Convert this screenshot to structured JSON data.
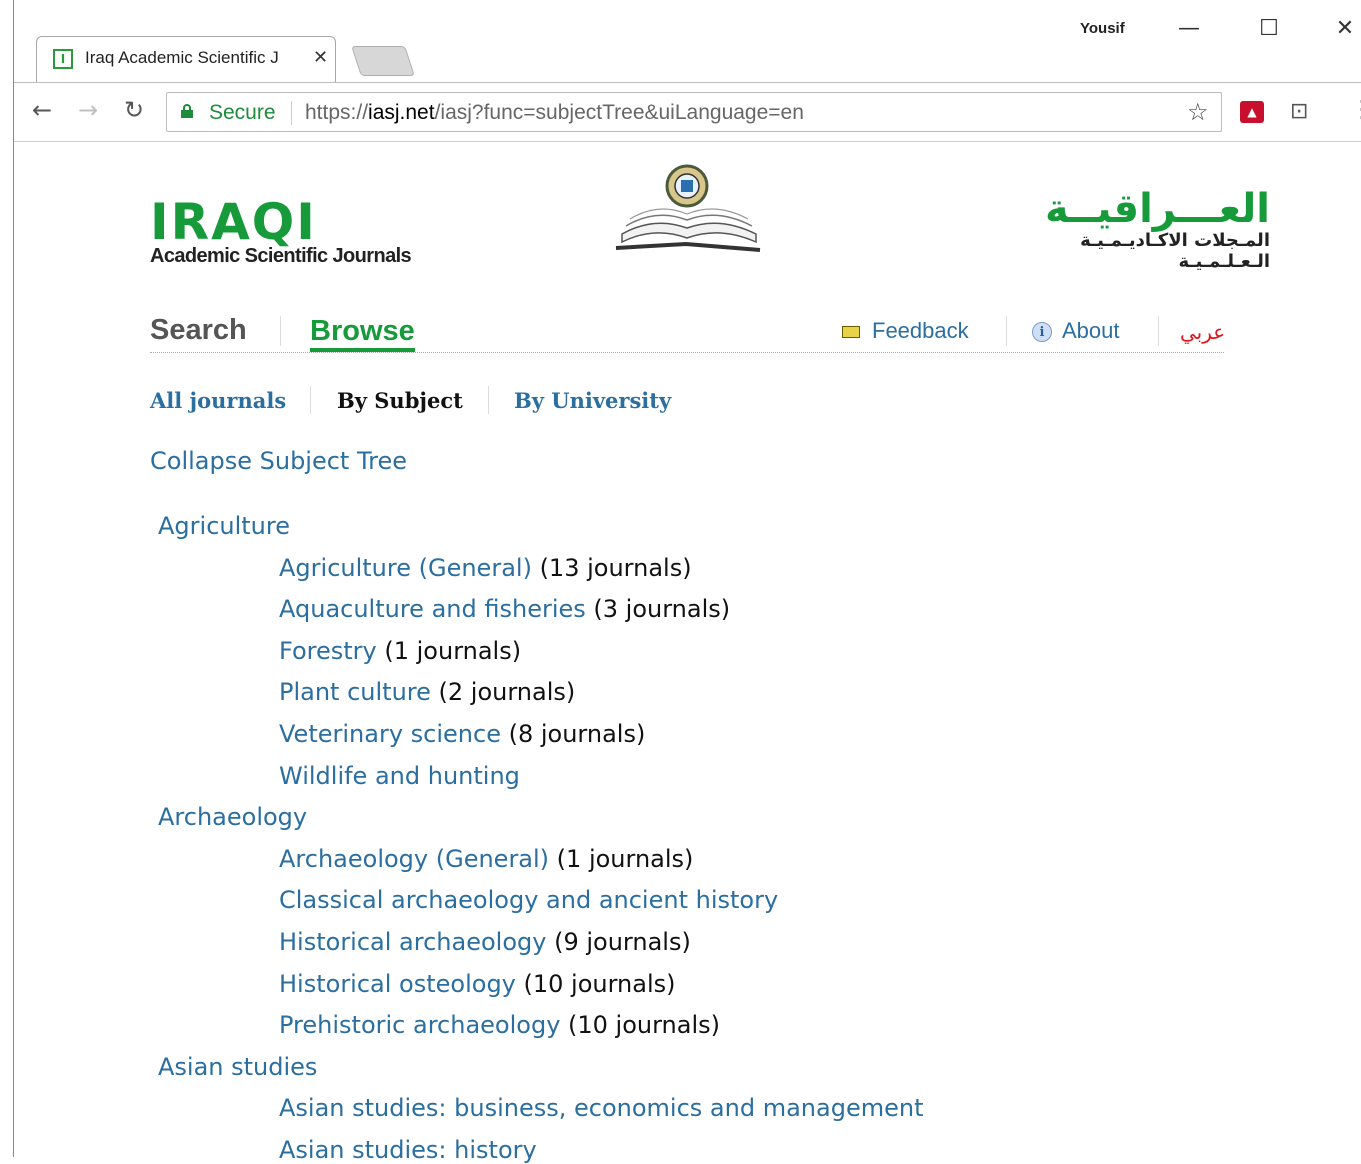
{
  "browser": {
    "tab_title": "Iraq Academic Scientific J",
    "tab_favicon": "I",
    "user": "Yousif",
    "secure_label": "Secure",
    "url_prefix": "https://",
    "url_host": "iasj.net",
    "url_path": "/iasj?func=subjectTree&uiLanguage=en"
  },
  "header": {
    "logo_title": "IRAQI",
    "logo_subtitle": "Academic Scientific Journals",
    "logo_arabic_main": "العـــراقيــة",
    "logo_arabic_sub": "المـجلات الاكـاديـمـيـة الـعـلـمـيـة"
  },
  "mainnav": {
    "search": "Search",
    "browse": "Browse",
    "feedback": "Feedback",
    "about": "About",
    "arabic": "عربي"
  },
  "subnav": {
    "all_journals": "All journals",
    "by_subject": "By Subject",
    "by_university": "By University"
  },
  "collapse_label": "Collapse Subject Tree",
  "tree": [
    {
      "category": "Agriculture",
      "subjects": [
        {
          "name": "Agriculture (General)",
          "count": "(13 journals)"
        },
        {
          "name": "Aquaculture and fisheries",
          "count": "(3 journals)"
        },
        {
          "name": "Forestry",
          "count": "(1 journals)"
        },
        {
          "name": "Plant culture",
          "count": "(2 journals)"
        },
        {
          "name": "Veterinary science",
          "count": "(8 journals)"
        },
        {
          "name": "Wildlife and hunting",
          "count": ""
        }
      ]
    },
    {
      "category": "Archaeology",
      "subjects": [
        {
          "name": "Archaeology (General)",
          "count": "(1 journals)"
        },
        {
          "name": "Classical archaeology and ancient history",
          "count": ""
        },
        {
          "name": "Historical archaeology",
          "count": "(9 journals)"
        },
        {
          "name": "Historical osteology",
          "count": "(10 journals)"
        },
        {
          "name": "Prehistoric archaeology",
          "count": "(10 journals)"
        }
      ]
    },
    {
      "category": "Asian studies",
      "subjects": [
        {
          "name": "Asian studies: business, economics and management",
          "count": ""
        },
        {
          "name": "Asian studies: history",
          "count": ""
        }
      ]
    }
  ],
  "colors": {
    "link": "#2b6ea0",
    "brand_green": "#169a3a",
    "arabic_red": "#e0161b"
  }
}
